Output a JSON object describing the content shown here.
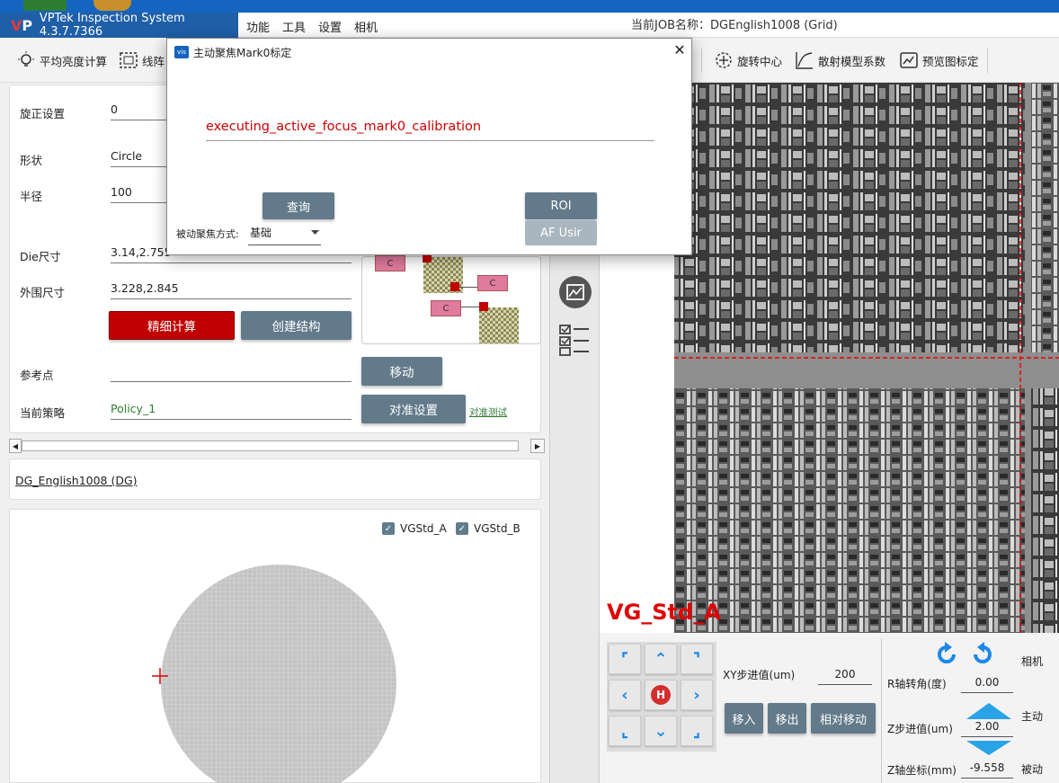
{
  "app": {
    "title": "VPTek Inspection System 4.3.7.7366",
    "logo": "VP",
    "job_label": "当前JOB名称：DGEnglish1008 (Grid)"
  },
  "menu": [
    "功能",
    "工具",
    "设置",
    "相机"
  ],
  "toolbar": {
    "items": [
      {
        "label": "平均亮度计算",
        "icon": "bulb-icon"
      },
      {
        "label": "线阵",
        "icon": "line-array-icon"
      },
      {
        "label": "旋转中心",
        "icon": "crosshair-icon"
      },
      {
        "label": "散射模型系数",
        "icon": "curve-icon"
      },
      {
        "label": "预览图标定",
        "icon": "preview-icon"
      }
    ]
  },
  "left": {
    "rotation_label": "旋正设置",
    "rotation_value": "0",
    "shape_label": "形状",
    "shape_value": "Circle",
    "radius_label": "半径",
    "radius_value": "100",
    "die_label": "Die尺寸",
    "die_value": "3.14,2.755",
    "outer_label": "外围尺寸",
    "outer_value": "3.228,2.845",
    "fine_calc": "精细计算",
    "create_struct": "创建结构",
    "ref_label": "参考点",
    "ref_value": "",
    "move": "移动",
    "policy_label": "当前策略",
    "policy_value": "Policy_1",
    "align_settings": "对准设置",
    "align_test": "对准测试",
    "diagram_marks": [
      "C",
      "C",
      "C"
    ]
  },
  "dg": {
    "name": "DG_English1008 (DG)"
  },
  "wafer": {
    "checkbox_a": "VGStd_A",
    "checkbox_b": "VGStd_B"
  },
  "image": {
    "overlay_label": "VG_Std_A"
  },
  "controls": {
    "xy_step_label": "XY步进值(um)",
    "xy_step_value": "200",
    "move_in": "移入",
    "move_out": "移出",
    "relative_move": "相对移动",
    "home": "H",
    "r_angle_label": "R轴转角(度)",
    "r_angle_value": "0.00",
    "z_step_label": "Z步进值(um)",
    "z_step_value": "2.00",
    "z_coord_label": "Z轴坐标(mm)",
    "z_coord_value": "-9.558",
    "camera": "相机",
    "active": "主动",
    "passive": "被动"
  },
  "dialog": {
    "title": "主动聚焦Mark0标定",
    "icon_text": "vis",
    "message": "executing_active_focus_mark0_calibration",
    "query": "查询",
    "roi": "ROI",
    "af": "AF Usir",
    "mode_label": "被动聚焦方式:",
    "mode_value": "基础"
  },
  "colors": {
    "accent": "#627a8a",
    "danger": "#c00000",
    "brand": "#1f5fa8",
    "arrow": "#1e88e5"
  }
}
